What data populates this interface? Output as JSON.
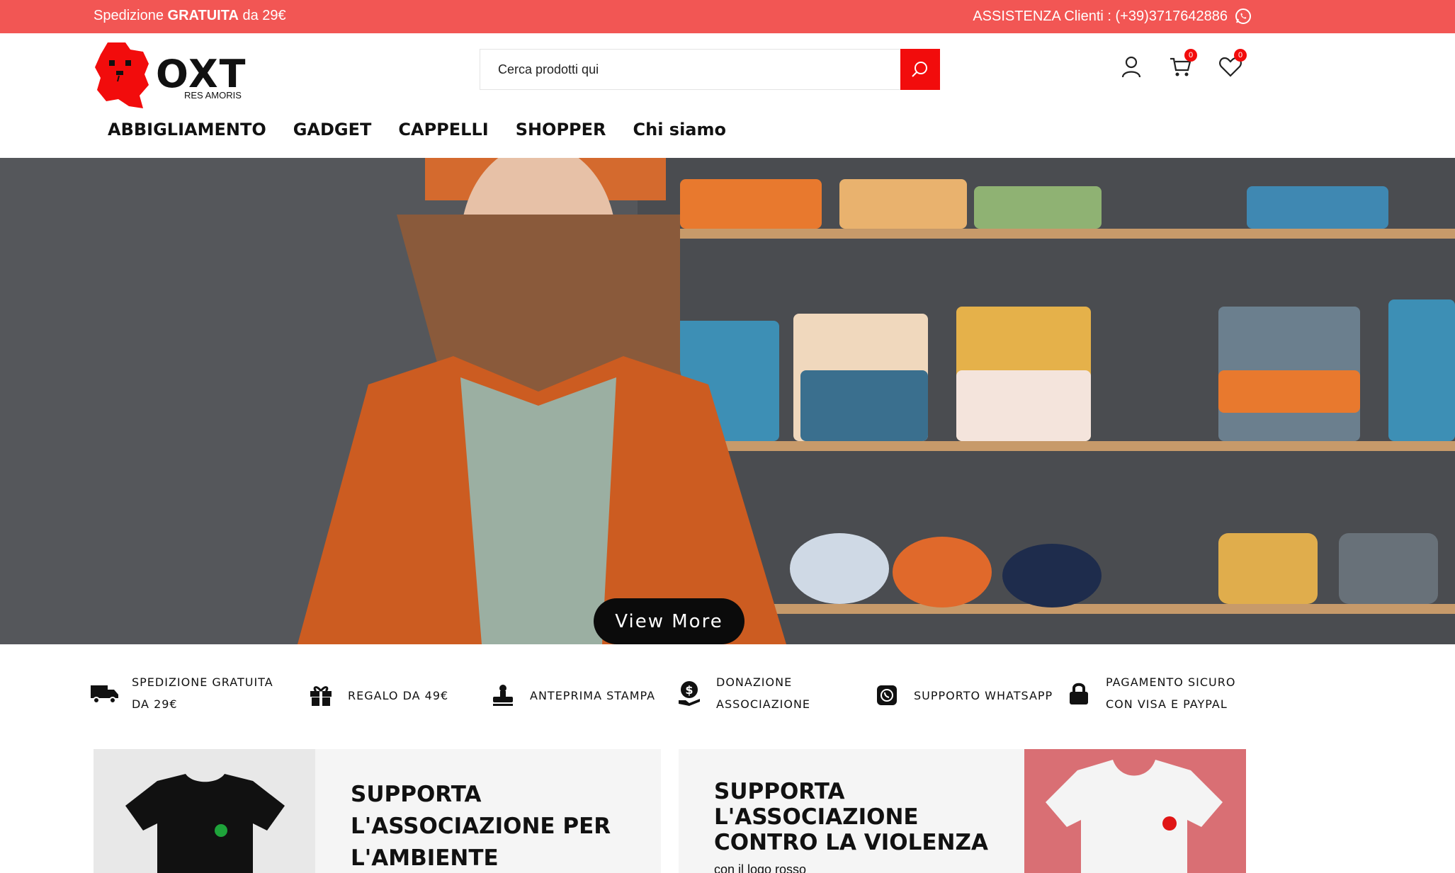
{
  "topbar": {
    "shipping_prefix": "Spedizione",
    "shipping_bold": "GRATUITA",
    "shipping_suffix": "da 29€",
    "support": "ASSISTENZA Clienti : (+39)3717642886",
    "support_icon": "whatsapp-icon",
    "background": "#f25654"
  },
  "brand": {
    "name": "OXT",
    "tagline": "RES AMORIS",
    "accent": "#f20c0c"
  },
  "search": {
    "placeholder": "Cerca prodotti qui",
    "button_icon": "search-icon"
  },
  "header_icons": {
    "account_icon": "user-icon",
    "cart_icon": "cart-icon",
    "cart_count": "0",
    "wishlist_icon": "heart-icon",
    "wishlist_count": "0"
  },
  "nav": {
    "items": [
      {
        "label": "ABBIGLIAMENTO"
      },
      {
        "label": "GADGET"
      },
      {
        "label": "CAPPELLI"
      },
      {
        "label": "SHOPPER"
      },
      {
        "label": "Chi siamo"
      }
    ]
  },
  "hero": {
    "button_label": "View More"
  },
  "features": [
    {
      "icon": "truck-icon",
      "line1": "SPEDIZIONE GRATUITA",
      "line2": "DA 29€"
    },
    {
      "icon": "gift-icon",
      "line1": "REGALO DA 49€",
      "line2": ""
    },
    {
      "icon": "stamp-icon",
      "line1": "ANTEPRIMA STAMPA",
      "line2": ""
    },
    {
      "icon": "donation-icon",
      "line1": "DONAZIONE",
      "line2": "ASSOCIAZIONE"
    },
    {
      "icon": "whatsapp-icon",
      "line1": "SUPPORTO WHATSAPP",
      "line2": ""
    },
    {
      "icon": "lock-icon",
      "line1": "PAGAMENTO SICURO",
      "line2": "CON VISA E PAYPAL"
    }
  ],
  "promos": [
    {
      "title": "SUPPORTA L'ASSOCIAZIONE PER L'AMBIENTE",
      "subtitle": ""
    },
    {
      "title": "SUPPORTA L'ASSOCIAZIONE CONTRO LA VIOLENZA",
      "subtitle": "con il logo rosso"
    }
  ]
}
